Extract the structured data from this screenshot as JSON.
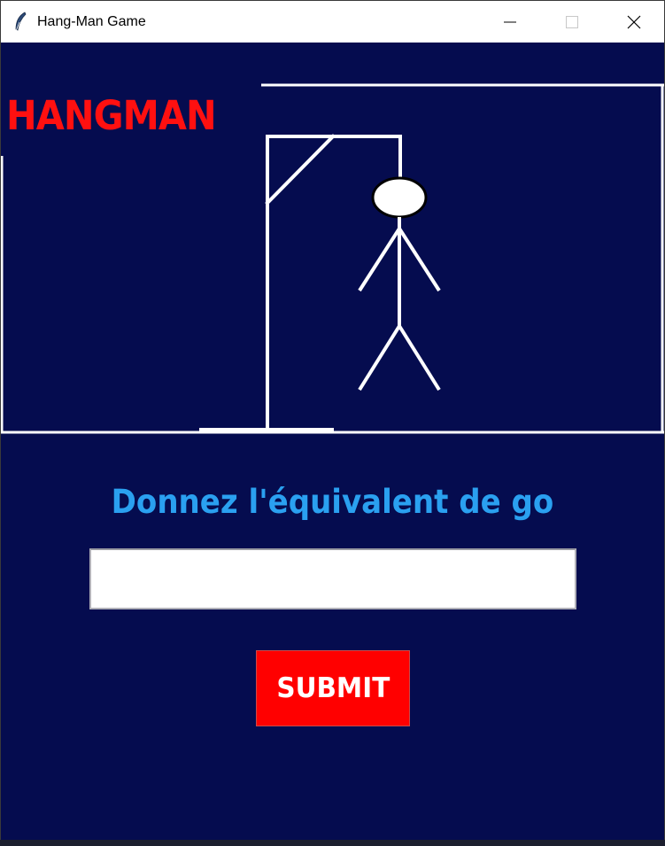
{
  "window": {
    "title": "Hang-Man Game",
    "icon": "feather-icon"
  },
  "game": {
    "heading": "HANGMAN",
    "prompt": "Donnez l'équivalent de go",
    "answer_value": "",
    "submit_label": "SUBMIT"
  },
  "colors": {
    "background": "#050c4f",
    "heading": "#ff1010",
    "prompt": "#2aa0f0",
    "submit_bg": "#ff0000",
    "drawing": "#ffffff"
  }
}
